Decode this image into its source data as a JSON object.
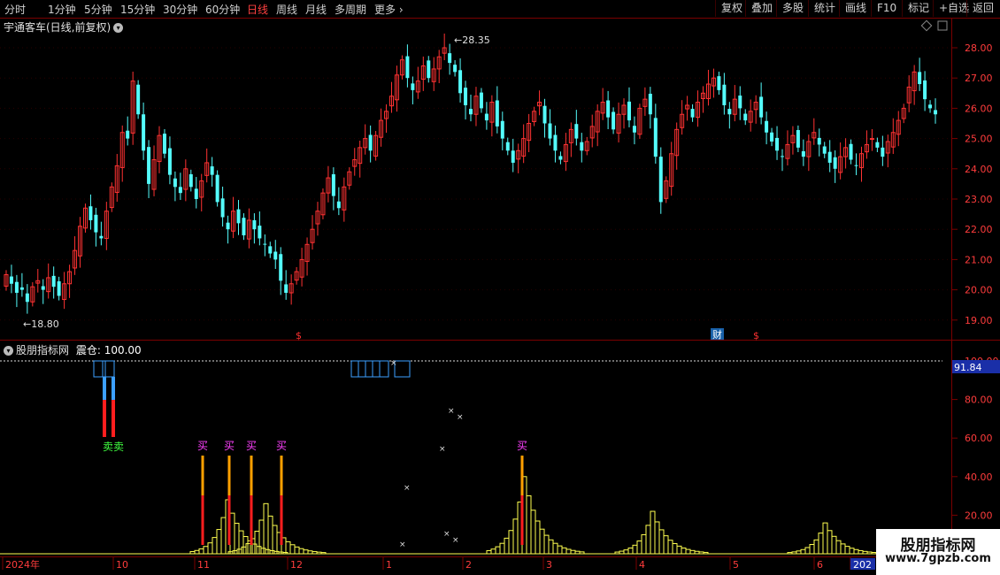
{
  "toolbar": {
    "periods": [
      "分时",
      "1分钟",
      "5分钟",
      "15分钟",
      "30分钟",
      "60分钟",
      "日线",
      "周线",
      "月线",
      "多周期",
      "更多"
    ],
    "active_period": "日线",
    "right_buttons": [
      "复权",
      "叠加",
      "多股",
      "统计",
      "画线",
      "F10",
      "标记",
      "+自选",
      "返回"
    ]
  },
  "chart_title": "宇通客车(日线,前复权)",
  "indicator_title": "股朋指标网",
  "indicator_value": "震仓: 100.00",
  "price_axis": [
    "28.00",
    "27.00",
    "26.00",
    "25.00",
    "24.00",
    "23.00",
    "22.00",
    "21.00",
    "20.00",
    "19.00"
  ],
  "ind_axis": [
    "100.00",
    "80.00",
    "60.00",
    "40.00",
    "20.00"
  ],
  "ind_current": "91.84",
  "high_label": "28.35",
  "low_label": "18.80",
  "date_axis": [
    "2024年",
    "10",
    "11",
    "12",
    "1",
    "2",
    "3",
    "4",
    "5",
    "6",
    "202"
  ],
  "markers": {
    "dollar": "$",
    "cai": "财"
  },
  "signals": {
    "buy": "买",
    "sell": "卖"
  },
  "watermark": {
    "line1": "股朋指标网",
    "line2": "www.7gpzb.com"
  },
  "colors": {
    "up": "#ff3232",
    "down": "#54fcfc",
    "bg": "#000000",
    "axis": "#7a0000",
    "yellow": "#ffff50",
    "signal_red": "#ff1e1e",
    "signal_orange": "#ffa000",
    "signal_blue": "#3ca0ff"
  },
  "chart_data": {
    "type": "candlestick",
    "series_name": "宇通客车",
    "y_range": [
      18.5,
      28.5
    ],
    "close_series": [
      20.5,
      20.2,
      19.9,
      20.0,
      19.6,
      20.1,
      20.3,
      20.0,
      20.4,
      20.1,
      19.8,
      20.2,
      20.6,
      21.3,
      22.1,
      22.7,
      22.3,
      21.9,
      21.7,
      22.6,
      23.4,
      24.1,
      25.2,
      25.0,
      26.9,
      25.8,
      24.6,
      23.5,
      24.3,
      25.1,
      24.5,
      23.8,
      23.4,
      23.2,
      24.0,
      23.4,
      23.0,
      23.6,
      24.2,
      23.8,
      22.9,
      22.4,
      22.0,
      22.6,
      22.2,
      21.8,
      22.3,
      22.0,
      21.7,
      21.5,
      21.2,
      21.0,
      20.3,
      19.9,
      20.2,
      20.6,
      21.0,
      21.5,
      22.0,
      22.6,
      23.2,
      23.7,
      23.1,
      22.7,
      23.4,
      23.9,
      24.3,
      24.7,
      25.0,
      24.6,
      25.1,
      25.6,
      25.9,
      26.4,
      27.1,
      27.6,
      27.0,
      26.6,
      26.9,
      27.4,
      27.0,
      27.3,
      27.7,
      28.0,
      27.5,
      27.2,
      26.5,
      26.1,
      25.8,
      26.4,
      26.0,
      25.6,
      26.2,
      25.4,
      25.0,
      24.6,
      24.2,
      24.6,
      25.0,
      25.5,
      25.9,
      26.2,
      25.5,
      25.0,
      24.6,
      24.3,
      24.8,
      25.3,
      25.0,
      24.6,
      24.9,
      25.4,
      25.9,
      26.2,
      25.7,
      25.3,
      25.8,
      26.1,
      25.6,
      25.2,
      26.0,
      26.3,
      25.8,
      24.4,
      22.9,
      23.6,
      24.5,
      25.3,
      25.8,
      26.1,
      25.7,
      26.2,
      26.5,
      26.8,
      27.0,
      26.6,
      26.1,
      25.8,
      26.3,
      26.0,
      25.6,
      25.9,
      26.2,
      25.7,
      25.2,
      24.9,
      24.6,
      24.4,
      24.8,
      25.1,
      24.7,
      24.4,
      24.9,
      25.2,
      24.8,
      24.5,
      24.2,
      24.0,
      24.4,
      24.7,
      24.3,
      24.1,
      24.5,
      24.8,
      25.0,
      24.7,
      24.4,
      24.9,
      25.2,
      25.6,
      26.0,
      26.7,
      27.2,
      26.8,
      26.3,
      26.0,
      25.8
    ]
  }
}
